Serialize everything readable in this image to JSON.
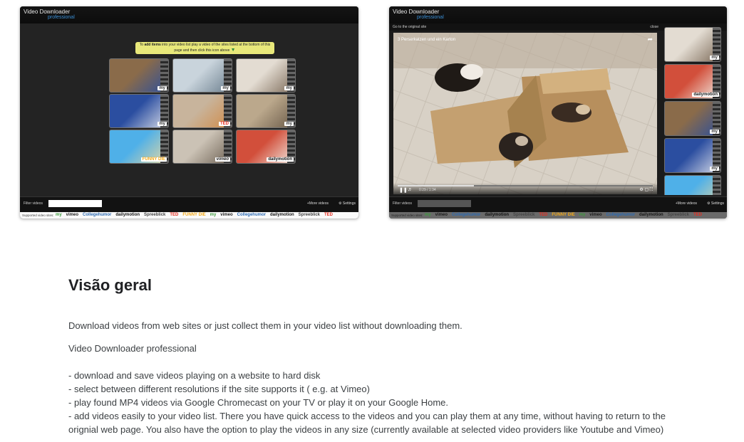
{
  "screenshot1": {
    "app_name": "Video Downloader",
    "app_sub": "professional",
    "hint_prefix": "To ",
    "hint_bold": "add items",
    "hint_rest": " into your video list play a video of the sites listed at the bottom of this page and then click this icon above",
    "thumbnails": [
      {
        "badge": "my",
        "badge_style": "myvi",
        "colors": [
          "#8a6b4a",
          "#2d4f9a"
        ]
      },
      {
        "badge": "my",
        "badge_style": "myvi",
        "colors": [
          "#c9d4dc",
          "#6a7d8c"
        ]
      },
      {
        "badge": "my",
        "badge_style": "myvi",
        "colors": [
          "#e3dcd2",
          "#7c6a58"
        ]
      },
      {
        "badge": "my",
        "badge_style": "myvi",
        "colors": [
          "#2b4ea0",
          "#d7dbe8"
        ]
      },
      {
        "badge": "TED",
        "badge_style": "ted",
        "colors": [
          "#c8b49c",
          "#d18b47"
        ]
      },
      {
        "badge": "my",
        "badge_style": "myvi",
        "colors": [
          "#bba88c",
          "#6a5a48"
        ]
      },
      {
        "badge": "FUNNY DIE",
        "badge_style": "funny",
        "colors": [
          "#4fb0e8",
          "#e6d8a3"
        ]
      },
      {
        "badge": "vimeo",
        "badge_style": "vimeo",
        "colors": [
          "#cbc2b5",
          "#6c6052"
        ]
      },
      {
        "badge": "dailymotion",
        "badge_style": "daily",
        "colors": [
          "#d24f3b",
          "#f2efe6"
        ]
      }
    ],
    "filter_label": "Filter videos",
    "more_videos": "+More videos",
    "settings": "⚙ Settings",
    "supported_label": "Supported video sites:",
    "supported_logos": [
      "my",
      "vimeo",
      "Collegehumor",
      "dailymotion",
      "Spreeblick",
      "TED",
      "FUNNY DIE",
      "my",
      "vimeo",
      "Collegehumor",
      "dailymotion",
      "Spreeblick",
      "TED"
    ]
  },
  "screenshot2": {
    "app_name": "Video Downloader",
    "app_sub": "professional",
    "go_original": "Go to the original site",
    "close": "close",
    "video_title": "3 Perserkatzen und ein Karton",
    "time": "0:29 / 1:34",
    "progress": 0.3,
    "side_thumbs": [
      {
        "badge": "my",
        "badge_style": "myvi",
        "colors": [
          "#e3dcd2",
          "#7c6a58"
        ]
      },
      {
        "badge": "dailymotion",
        "badge_style": "daily",
        "colors": [
          "#d24f3b",
          "#f2efe6"
        ]
      },
      {
        "badge": "my",
        "badge_style": "myvi",
        "colors": [
          "#8a6b4a",
          "#2d4f9a"
        ]
      },
      {
        "badge": "my",
        "badge_style": "myvi",
        "colors": [
          "#2b4ea0",
          "#d7dbe8"
        ]
      },
      {
        "badge": "",
        "badge_style": "myvi",
        "colors": [
          "#4fb0e8",
          "#e6d8a3"
        ]
      }
    ],
    "filter_label": "Filter videos",
    "more_videos": "+More videos",
    "settings": "⚙ Settings",
    "supported_label": "Supported video sites:",
    "supported_logos": [
      "my",
      "vimeo",
      "Collegehumor",
      "dailymotion",
      "Spreeblick",
      "TED",
      "FUNNY DIE",
      "my",
      "vimeo",
      "Collegehumor",
      "dailymotion",
      "Spreeblick",
      "TED"
    ]
  },
  "overview": {
    "title": "Visão geral",
    "p1": "Download videos from web sites or just collect them in your video list without downloading them.",
    "p2": "Video Downloader professional",
    "features": [
      "- download and save videos playing on a website to hard disk",
      "- select between different resolutions if the site supports it ( e.g. at Vimeo)",
      "- play found MP4 videos via Google Chromecast on your TV or play it on your Google Home.",
      "- add videos easily to your video list. There you have quick access to the videos and you can play them at any time, without having to return to the orignial web page. You also have the option to play the videos in any size (currently available at selected video providers like Youtube and Vimeo)"
    ]
  }
}
